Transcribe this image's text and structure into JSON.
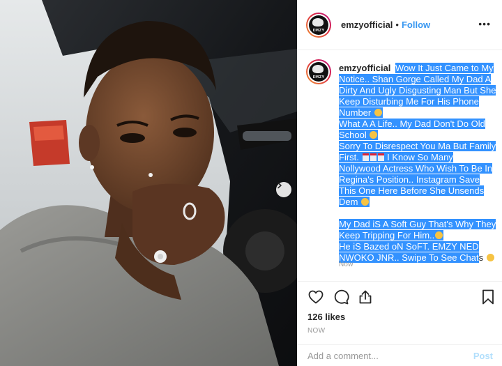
{
  "post": {
    "username": "emzyofficial",
    "follow_label": "Follow",
    "separator": "•",
    "more_label": "•••",
    "avatar_text": "EMZY",
    "caption_lines": [
      "Wow It Just Came to My Notice.. Shan Gorge Called My Dad A Dirty And Ugly Disgusting Man But She Keep Disturbing Me For His Phone Number",
      "What A A Life.. My Dad Don't Do Old School",
      "Sorry To Disrespect You Ma But Family First.",
      "I Know So Many Nollywood Actress Who Wish To Be In Regina's Position.. Instagram Save This One Here Before She Unsends Dem",
      "My Dad iS A Soft Guy That's Why They Keep Tripping For Him..",
      "He iS Bazed oN SoFT.",
      "EMZY NED NWOKO JNR.. Swipe To See Chat",
      "s"
    ],
    "caption_time": "Now",
    "likes": "126 likes",
    "post_time": "NOW",
    "comment_placeholder": "Add a comment...",
    "post_button": "Post"
  },
  "icons": {
    "like": "heart-icon",
    "comment": "comment-icon",
    "share": "share-icon",
    "save": "bookmark-icon",
    "next": "chevron-right-icon"
  },
  "colors": {
    "accent": "#3897f0",
    "selection": "#3392ff",
    "muted": "#999999",
    "post_disabled": "#b2dffc"
  }
}
